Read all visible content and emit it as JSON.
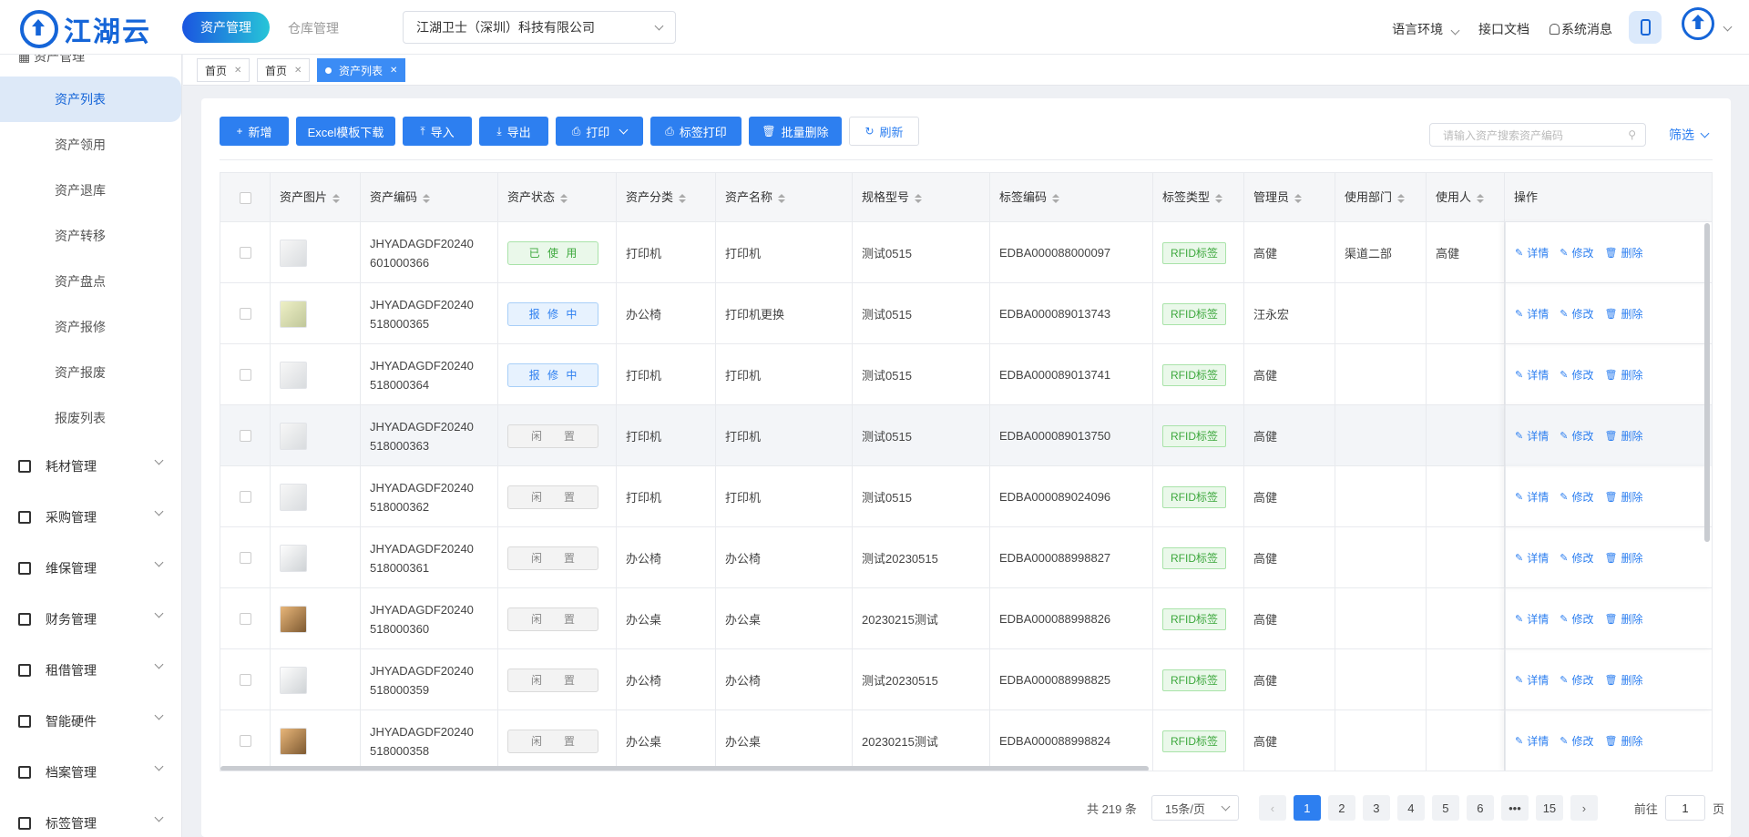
{
  "header": {
    "logo_text": "江湖云",
    "nav": [
      {
        "label": "资产管理"
      },
      {
        "label": "仓库管理"
      }
    ],
    "company_select": "江湖卫士（深圳）科技有限公司",
    "right": {
      "language": "语言环境",
      "api_docs": "接口文档",
      "messages": "系统消息"
    }
  },
  "sidebar": {
    "group_title": "资产管理",
    "subitems": [
      "资产列表",
      "资产领用",
      "资产退库",
      "资产转移",
      "资产盘点",
      "资产报修",
      "资产报废",
      "报废列表"
    ],
    "groups": [
      "耗材管理",
      "采购管理",
      "维保管理",
      "财务管理",
      "租借管理",
      "智能硬件",
      "档案管理",
      "标签管理"
    ]
  },
  "tabs": [
    {
      "label": "首页"
    },
    {
      "label": "首页"
    },
    {
      "label": "资产列表"
    }
  ],
  "toolbar": {
    "add": "新增",
    "excel": "Excel模板下载",
    "import": "导入",
    "export": "导出",
    "print": "打印",
    "label_print": "标签打印",
    "batch_delete": "批量删除",
    "refresh": "刷新"
  },
  "search": {
    "placeholder": "请输入资产搜索资产编码"
  },
  "filter": "筛选",
  "table": {
    "columns": [
      "资产图片",
      "资产编码",
      "资产状态",
      "资产分类",
      "资产名称",
      "规格型号",
      "标签编码",
      "标签类型",
      "管理员",
      "使用部门",
      "使用人",
      "操作"
    ],
    "ops": {
      "detail": "详情",
      "edit": "修改",
      "delete": "删除"
    },
    "rows": [
      {
        "img": "printer",
        "code": "JHYADAGDF20240\n601000366",
        "status": "已使用",
        "status_type": "used",
        "category": "打印机",
        "name": "打印机",
        "spec": "测试0515",
        "tag": "EDBA000088000097",
        "tag_type": "RFID标签",
        "admin": "高健",
        "dept": "渠道二部",
        "user": "高健"
      },
      {
        "img": "yellow",
        "code": "JHYADAGDF20240\n518000365",
        "status": "报修中",
        "status_type": "repair",
        "category": "办公椅",
        "name": "打印机更换",
        "spec": "测试0515",
        "tag": "EDBA000089013743",
        "tag_type": "RFID标签",
        "admin": "汪永宏",
        "dept": "",
        "user": ""
      },
      {
        "img": "printer",
        "code": "JHYADAGDF20240\n518000364",
        "status": "报修中",
        "status_type": "repair",
        "category": "打印机",
        "name": "打印机",
        "spec": "测试0515",
        "tag": "EDBA000089013741",
        "tag_type": "RFID标签",
        "admin": "高健",
        "dept": "",
        "user": ""
      },
      {
        "img": "printer",
        "code": "JHYADAGDF20240\n518000363",
        "status": "闲置",
        "status_type": "idle",
        "category": "打印机",
        "name": "打印机",
        "spec": "测试0515",
        "tag": "EDBA000089013750",
        "tag_type": "RFID标签",
        "admin": "高健",
        "dept": "",
        "user": ""
      },
      {
        "img": "printer",
        "code": "JHYADAGDF20240\n518000362",
        "status": "闲置",
        "status_type": "idle",
        "category": "打印机",
        "name": "打印机",
        "spec": "测试0515",
        "tag": "EDBA000089024096",
        "tag_type": "RFID标签",
        "admin": "高健",
        "dept": "",
        "user": ""
      },
      {
        "img": "chair",
        "code": "JHYADAGDF20240\n518000361",
        "status": "闲置",
        "status_type": "idle",
        "category": "办公椅",
        "name": "办公椅",
        "spec": "测试20230515",
        "tag": "EDBA000088998827",
        "tag_type": "RFID标签",
        "admin": "高健",
        "dept": "",
        "user": ""
      },
      {
        "img": "desk",
        "code": "JHYADAGDF20240\n518000360",
        "status": "闲置",
        "status_type": "idle",
        "category": "办公桌",
        "name": "办公桌",
        "spec": "20230215测试",
        "tag": "EDBA000088998826",
        "tag_type": "RFID标签",
        "admin": "高健",
        "dept": "",
        "user": ""
      },
      {
        "img": "chair",
        "code": "JHYADAGDF20240\n518000359",
        "status": "闲置",
        "status_type": "idle",
        "category": "办公椅",
        "name": "办公椅",
        "spec": "测试20230515",
        "tag": "EDBA000088998825",
        "tag_type": "RFID标签",
        "admin": "高健",
        "dept": "",
        "user": ""
      },
      {
        "img": "desk",
        "code": "JHYADAGDF20240\n518000358",
        "status": "闲置",
        "status_type": "idle",
        "category": "办公桌",
        "name": "办公桌",
        "spec": "20230215测试",
        "tag": "EDBA000088998824",
        "tag_type": "RFID标签",
        "admin": "高健",
        "dept": "",
        "user": ""
      }
    ]
  },
  "pagination": {
    "total": "共 219 条",
    "page_size": "15条/页",
    "pages": [
      "1",
      "2",
      "3",
      "4",
      "5",
      "6",
      "•••",
      "15"
    ],
    "current": "1",
    "goto_prefix": "前往",
    "goto_value": "1",
    "goto_suffix": "页"
  }
}
